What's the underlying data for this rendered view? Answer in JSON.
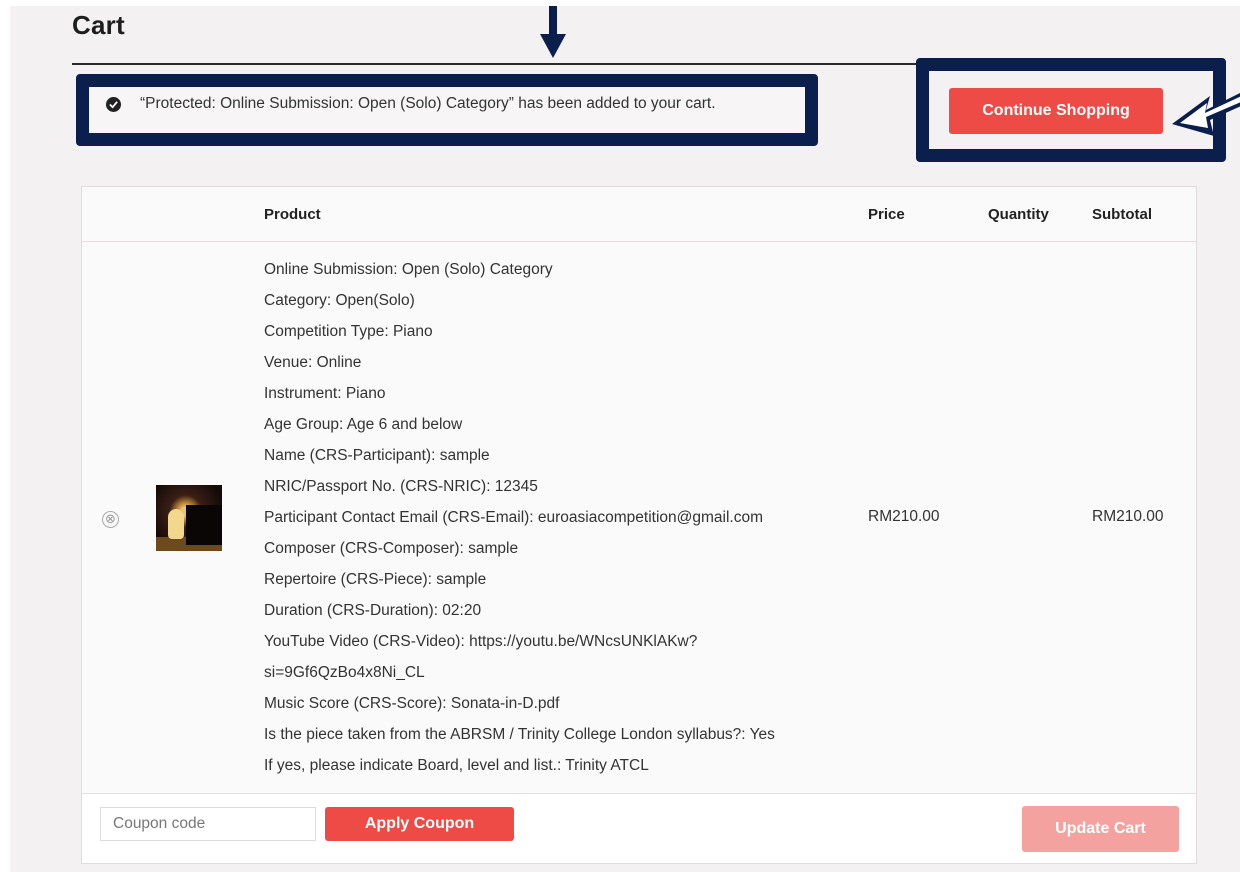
{
  "page": {
    "title": "Cart"
  },
  "notice": {
    "message": "“Protected: Online Submission: Open (Solo) Category” has been added to your cart."
  },
  "continue_label": "Continue Shopping",
  "table": {
    "headers": {
      "product": "Product",
      "price": "Price",
      "quantity": "Quantity",
      "subtotal": "Subtotal"
    },
    "item": {
      "remove_symbol": "⊗",
      "details": [
        "Online Submission: Open (Solo) Category",
        "Category: Open(Solo)",
        "Competition Type: Piano",
        "Venue: Online",
        "Instrument: Piano",
        "Age Group: Age 6 and below",
        "Name (CRS-Participant): sample",
        "NRIC/Passport No. (CRS-NRIC): 12345",
        "Participant Contact Email (CRS-Email): euroasiacompetition@gmail.com",
        "Composer (CRS-Composer): sample",
        "Repertoire (CRS-Piece): sample",
        "Duration (CRS-Duration): 02:20",
        "YouTube Video (CRS-Video): https://youtu.be/WNcsUNKlAKw?",
        "si=9Gf6QzBo4x8Ni_CL",
        "Music Score (CRS-Score): Sonata-in-D.pdf",
        "Is the piece taken from the ABRSM / Trinity College London syllabus?: Yes",
        "If yes, please indicate Board, level and list.: Trinity ATCL"
      ],
      "price": "RM210.00",
      "subtotal": "RM210.00"
    }
  },
  "coupon": {
    "placeholder": "Coupon code",
    "apply_label": "Apply Coupon"
  },
  "update_label": "Update Cart",
  "colors": {
    "accent": "#ee4b47",
    "highlight_border": "#0b1f4e",
    "disabled_button": "#f4a2a0"
  }
}
